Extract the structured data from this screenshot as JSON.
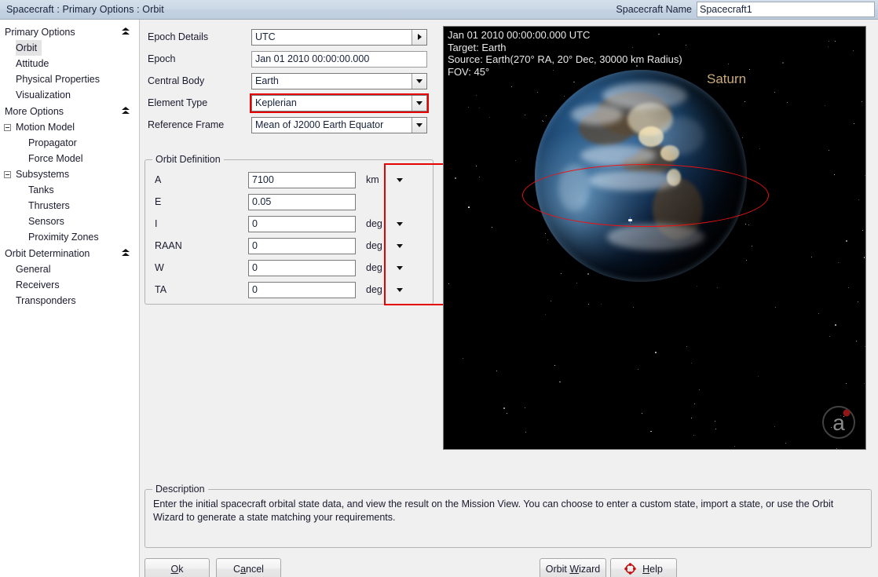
{
  "titlebar": {
    "title": "Spacecraft : Primary Options : Orbit",
    "spacecraft_name_label": "Spacecraft Name",
    "spacecraft_name_value": "Spacecraft1"
  },
  "sidebar": {
    "sections": [
      {
        "label": "Primary Options",
        "icon": "chevron-double-up-icon"
      },
      {
        "label": "More Options",
        "icon": "chevron-double-up-icon"
      },
      {
        "label": "Orbit Determination",
        "icon": "chevron-double-up-icon"
      }
    ],
    "primary_items": [
      {
        "label": "Orbit",
        "selected": true
      },
      {
        "label": "Attitude",
        "selected": false
      },
      {
        "label": "Physical Properties",
        "selected": false
      },
      {
        "label": "Visualization",
        "selected": false
      }
    ],
    "more_nodes": [
      {
        "label": "Motion Model",
        "children": [
          "Propagator",
          "Force Model"
        ]
      },
      {
        "label": "Subsystems",
        "children": [
          "Tanks",
          "Thrusters",
          "Sensors",
          "Proximity Zones"
        ]
      }
    ],
    "od_items": [
      "General",
      "Receivers",
      "Transponders"
    ]
  },
  "form": {
    "rows": [
      {
        "label": "Epoch Details",
        "value": "UTC",
        "control": "arrow-right",
        "highlight": false
      },
      {
        "label": "Epoch",
        "value": "Jan 01 2010 00:00:00.000",
        "control": "none",
        "highlight": false
      },
      {
        "label": "Central Body",
        "value": "Earth",
        "control": "arrow-down",
        "highlight": false
      },
      {
        "label": "Element Type",
        "value": "Keplerian",
        "control": "arrow-down",
        "highlight": true
      },
      {
        "label": "Reference Frame",
        "value": "Mean of J2000 Earth Equator",
        "control": "arrow-down",
        "highlight": false
      }
    ]
  },
  "orbit_definition": {
    "title": "Orbit Definition",
    "highlight_color": "#e60000",
    "rows": [
      {
        "label": "A",
        "value": "7100",
        "unit": "km",
        "unit_dropdown": true
      },
      {
        "label": "E",
        "value": "0.05",
        "unit": "",
        "unit_dropdown": false
      },
      {
        "label": "I",
        "value": "0",
        "unit": "deg",
        "unit_dropdown": true
      },
      {
        "label": "RAAN",
        "value": "0",
        "unit": "deg",
        "unit_dropdown": true
      },
      {
        "label": "W",
        "value": "0",
        "unit": "deg",
        "unit_dropdown": true
      },
      {
        "label": "TA",
        "value": "0",
        "unit": "deg",
        "unit_dropdown": true
      }
    ]
  },
  "view3d": {
    "overlay_lines": [
      "Jan 01 2010 00:00:00.000 UTC",
      "Target: Earth",
      "Source: Earth(270° RA, 20° Dec, 30000 km Radius)",
      "FOV: 45°"
    ],
    "overlay_text": "Jan 01 2010 00:00:00.000 UTC\nTarget: Earth\nSource: Earth(270° RA, 20° Dec, 30000 km Radius)\nFOV: 45°",
    "body_label": "Saturn",
    "body_label_color": "#cbab7c",
    "orbit_color": "#ee1111",
    "background_color": "#000000",
    "logo_letter": "a"
  },
  "description": {
    "title": "Description",
    "text": "Enter the initial spacecraft orbital state data, and view the result on the Mission View. You can choose to enter a custom state, import a state, or use the Orbit Wizard to generate a state matching your requirements."
  },
  "buttons": {
    "ok": {
      "pre": "",
      "mnemonic": "O",
      "post": "k"
    },
    "cancel": {
      "pre": "C",
      "mnemonic": "a",
      "post": "ncel"
    },
    "orbit_wizard": {
      "pre": "Orbit ",
      "mnemonic": "W",
      "post": "izard"
    },
    "help": {
      "pre": "",
      "mnemonic": "H",
      "post": "elp"
    }
  }
}
